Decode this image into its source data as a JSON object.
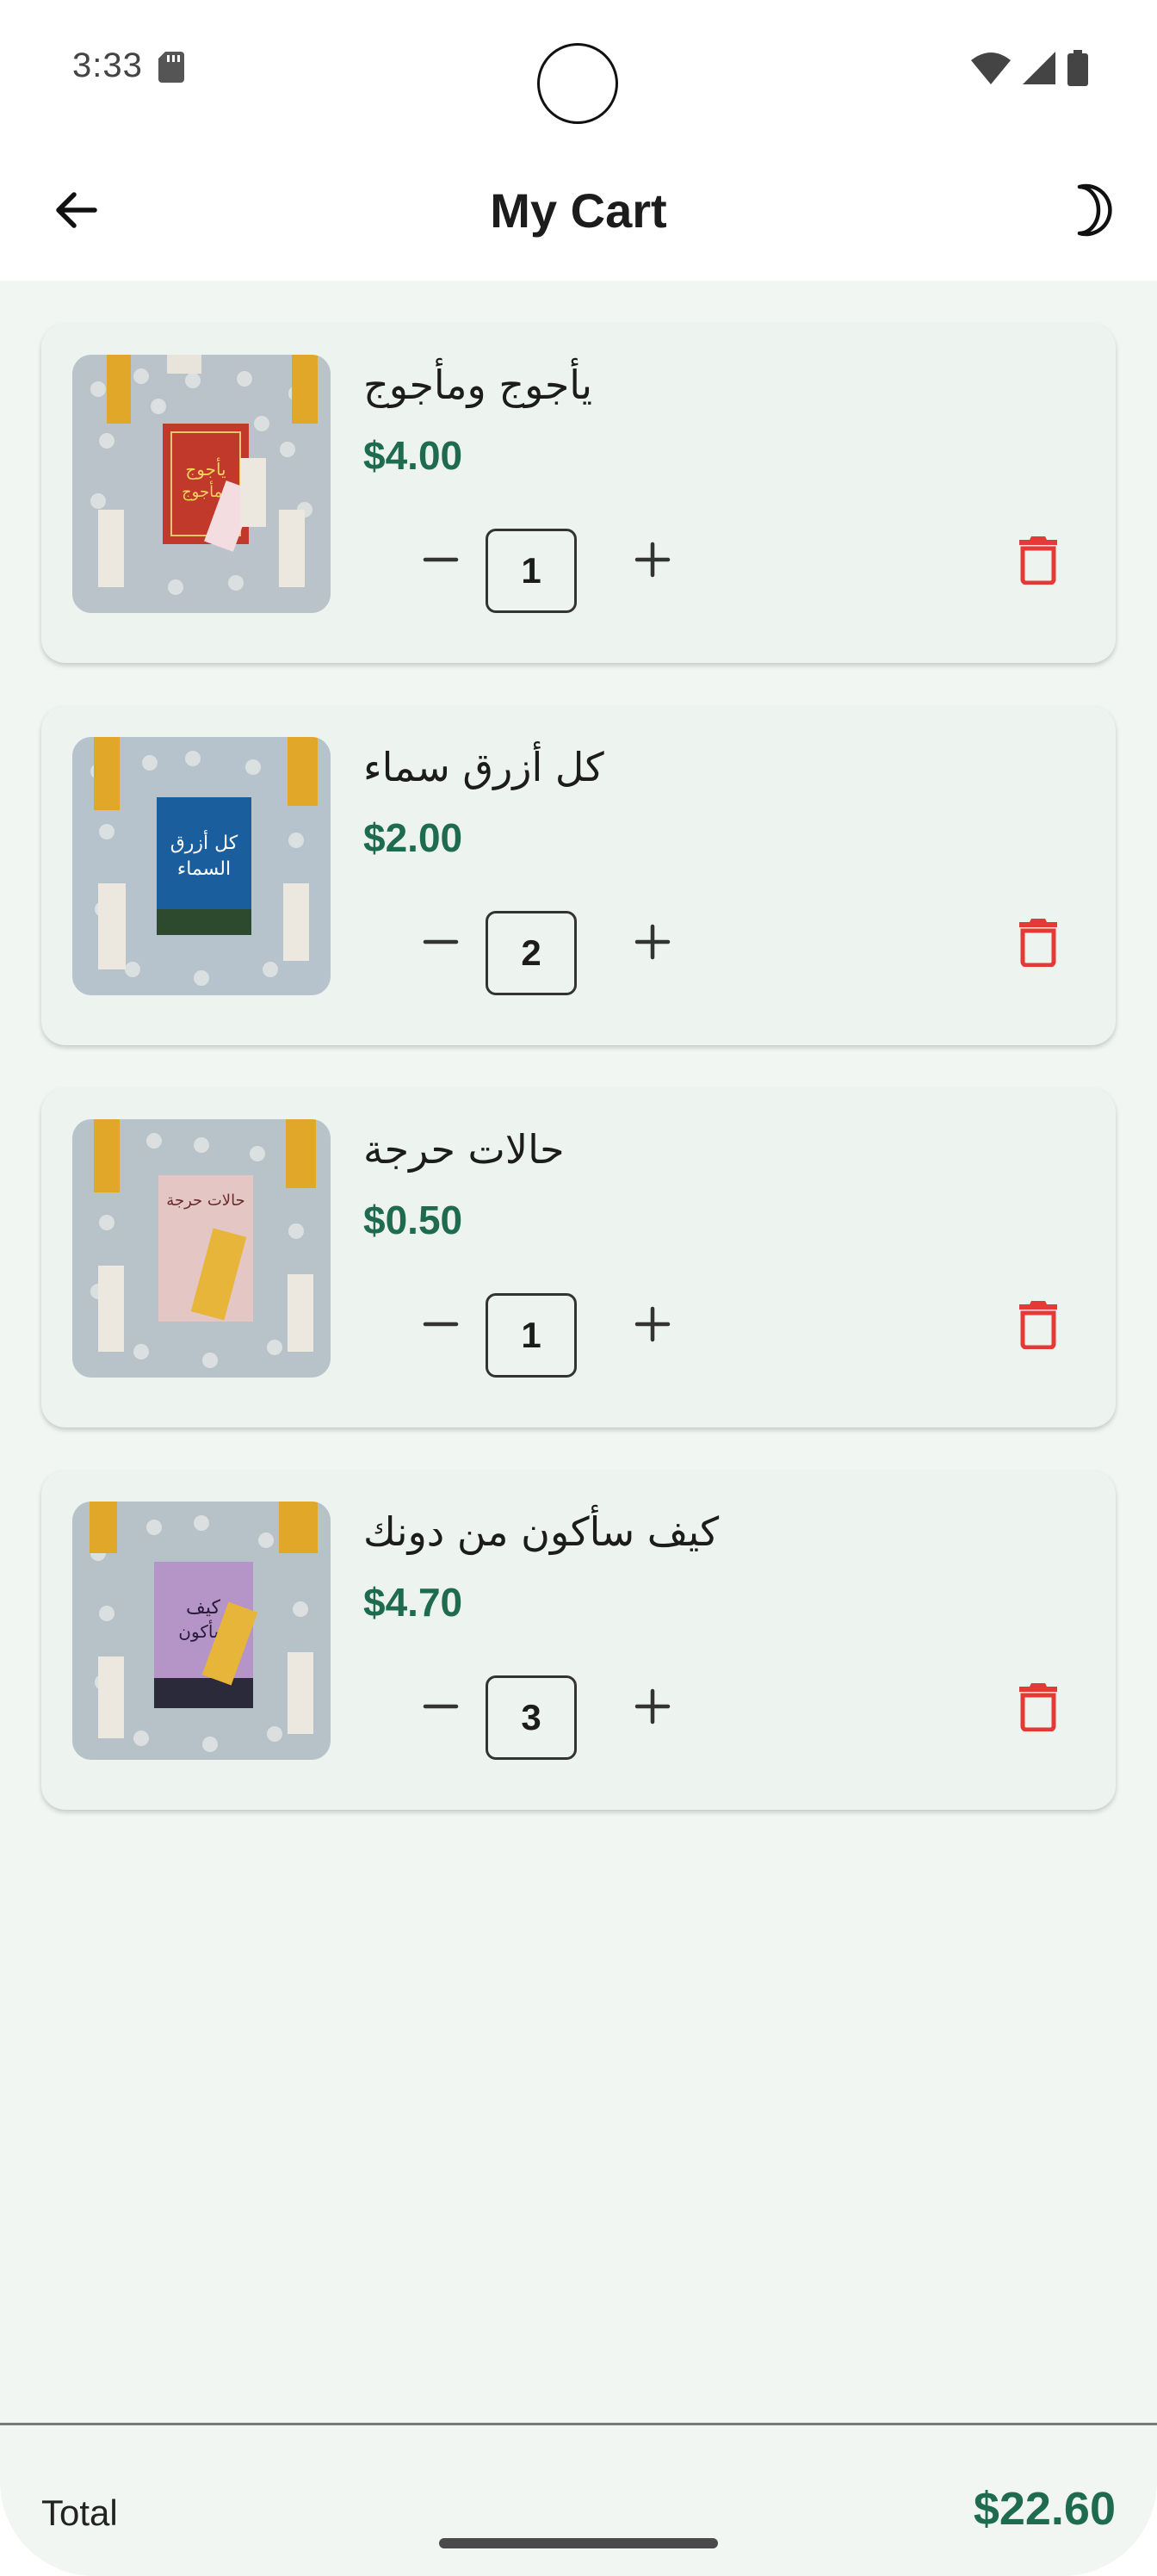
{
  "status_bar": {
    "time": "3:33"
  },
  "app_bar": {
    "title": "My Cart",
    "back_icon": "arrow-left-icon",
    "theme_icon": "moon-icon"
  },
  "cart": {
    "items": [
      {
        "title": "يأجوج ومأجوج",
        "price": "$4.00",
        "quantity": "1",
        "cover_title": "يأجوج ومأجوج",
        "cover_color": "#c0392b"
      },
      {
        "title": "كل أزرق سماء",
        "price": "$2.00",
        "quantity": "2",
        "cover_title": "كل أزرق السماء",
        "cover_color": "#1b5e9e"
      },
      {
        "title": "حالات حرجة",
        "price": "$0.50",
        "quantity": "1",
        "cover_title": "حالات حرجة",
        "cover_color": "#e4c7c4"
      },
      {
        "title": "كيف سأكون من دونك",
        "price": "$4.70",
        "quantity": "3",
        "cover_title": "كيف سأكون من دونك",
        "cover_color": "#b594c8"
      }
    ]
  },
  "summary": {
    "total_label": "Total",
    "total_value": "$22.60"
  },
  "colors": {
    "accent_green": "#1f6b4e",
    "delete_red": "#e53935",
    "background": "#f1f6f2",
    "card": "#edf3ee"
  }
}
